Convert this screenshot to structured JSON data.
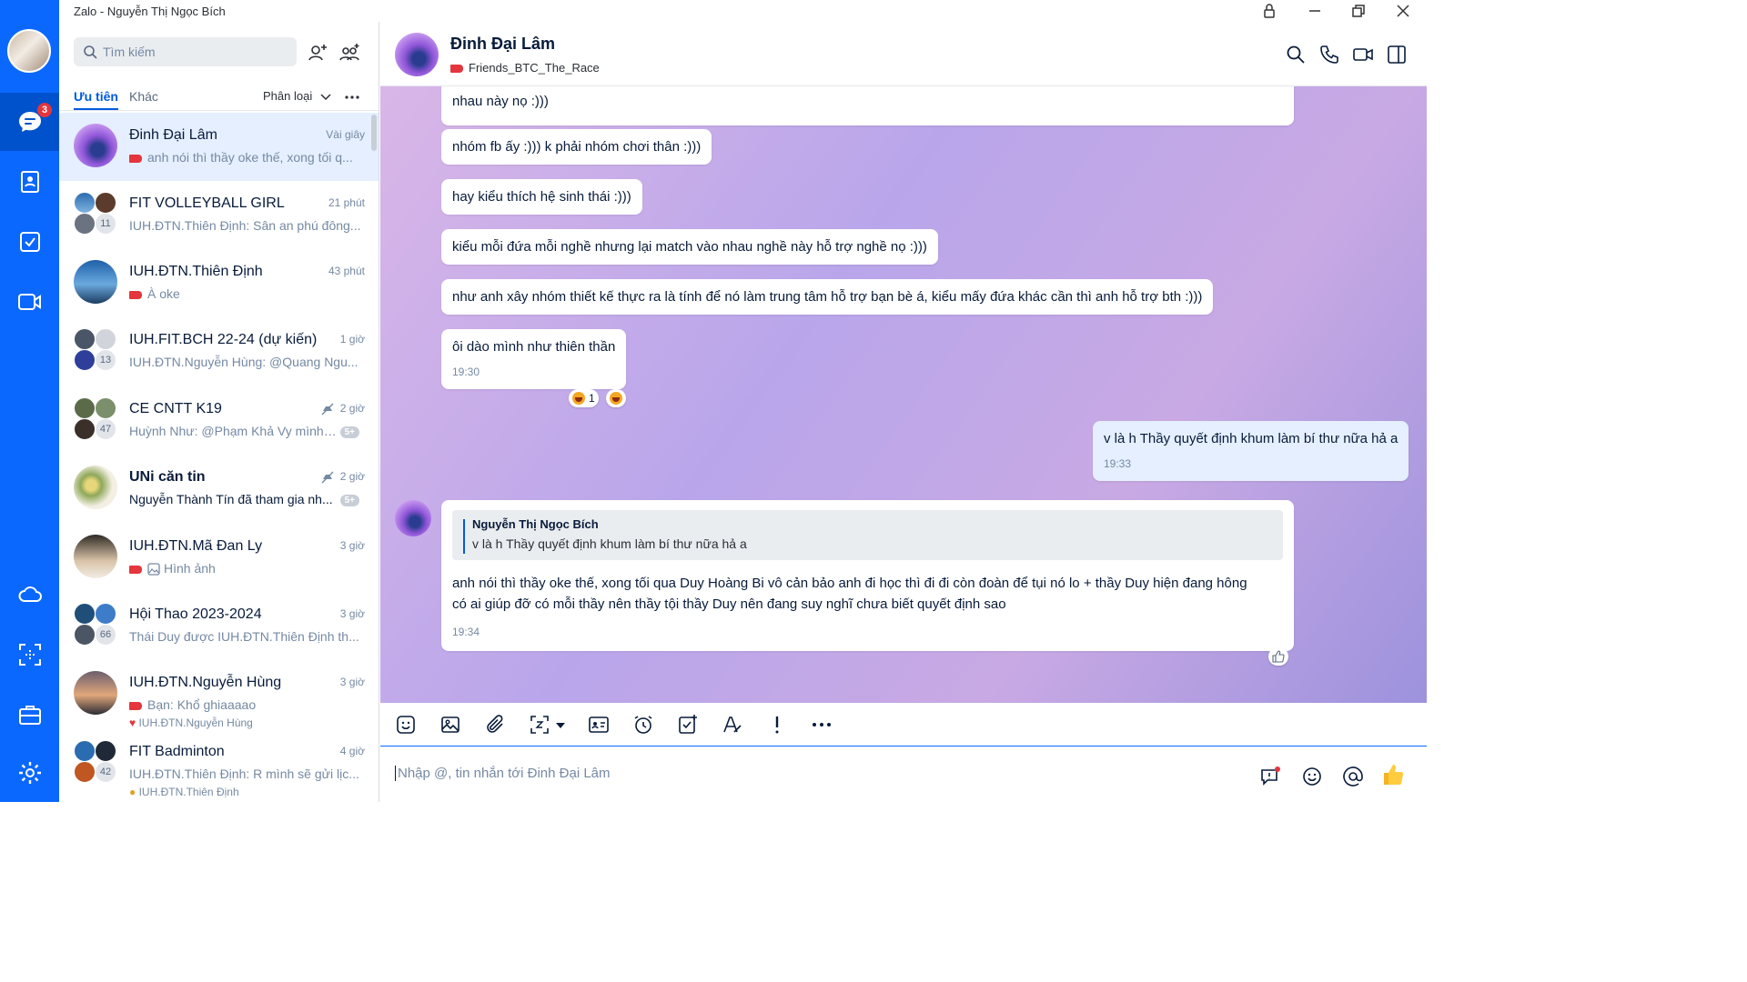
{
  "window": {
    "title": "Zalo - Nguyễn Thị Ngọc Bích"
  },
  "rail": {
    "unread_badge": "3"
  },
  "search": {
    "placeholder": "Tìm kiếm"
  },
  "list_tabs": {
    "priority": "Ưu tiên",
    "other": "Khác",
    "sort": "Phân loại"
  },
  "conversations": [
    {
      "name": "Đinh Đại Lâm",
      "time": "Vài giây",
      "preview": "anh nói thì thầy oke thế, xong tối q...",
      "tagged": true
    },
    {
      "name": "FIT VOLLEYBALL GIRL",
      "time": "21 phút",
      "preview": "IUH.ĐTN.Thiên Định: Sân an phú đông...",
      "members": "11"
    },
    {
      "name": "IUH.ĐTN.Thiên Định",
      "time": "43 phút",
      "preview": "À oke",
      "tagged": true
    },
    {
      "name": "IUH.FIT.BCH 22-24 (dự kiến)",
      "time": "1 giờ",
      "preview": "IUH.ĐTN.Nguyễn Hùng: @Quang Ngu...",
      "members": "13"
    },
    {
      "name": "CE CNTT K19",
      "time": "2 giờ",
      "preview": "Huỳnh Như: @Phạm Khả Vy mình l...",
      "members": "47",
      "unread": "5+"
    },
    {
      "name": "UNi căn tin",
      "time": "2 giờ",
      "preview": "Nguyễn Thành Tín đã tham gia nh...",
      "unread": "5+"
    },
    {
      "name": "IUH.ĐTN.Mã Đan Ly",
      "time": "3 giờ",
      "preview": "Hình ảnh",
      "tagged": true
    },
    {
      "name": "Hội Thao 2023-2024",
      "time": "3 giờ",
      "preview": "Thái Duy được IUH.ĐTN.Thiên Định th...",
      "members": "66"
    },
    {
      "name": "IUH.ĐTN.Nguyễn Hùng",
      "time": "3 giờ",
      "preview": "Bạn: Khổ ghiaaaao",
      "sub": "IUH.ĐTN.Nguyễn Hùng",
      "tagged": true
    },
    {
      "name": "FIT Badminton",
      "time": "4 giờ",
      "preview": "IUH.ĐTN.Thiên Định: R mình sẽ gửi lịc...",
      "sub": "IUH.ĐTN.Thiên Định",
      "members": "42"
    }
  ],
  "chat": {
    "name": "Đinh Đại Lâm",
    "label": "Friends_BTC_The_Race",
    "messages": [
      {
        "text": "nhau này nọ :)))"
      },
      {
        "text": "nhóm fb ấy :))) k phải nhóm chơi thân :)))"
      },
      {
        "text": "hay kiểu thích hệ sinh thái :)))"
      },
      {
        "text": "kiểu mỗi đứa mỗi nghề nhưng lại match vào nhau nghề này hỗ trợ nghề nọ :)))"
      },
      {
        "text": "như anh xây nhóm thiết kế thực ra là tính để nó làm trung tâm hỗ trợ bạn bè á, kiểu mấy đứa khác cần thì anh hỗ trợ bth :)))"
      },
      {
        "text": "ôi dào mình như thiên thần",
        "time": "19:30",
        "reaction_count": "1"
      },
      {
        "text": "v là h Thầy quyết định khum làm bí thư nữa hả a",
        "time": "19:33",
        "mine": true
      },
      {
        "quote_name": "Nguyễn Thị Ngọc Bích",
        "quote_text": "v là h Thầy quyết định khum làm bí thư nữa hả a",
        "line1": "anh nói thì thầy oke thế, xong tối qua Duy Hoàng Bi vô cản bảo anh đi học thì đi đi còn đoàn để tụi nó lo + thầy Duy hiện đang hông",
        "line2": "có ai giúp đỡ có mỗi thầy nên thầy tội thầy Duy nên đang suy nghĩ chưa biết quyết định sao",
        "time": "19:34"
      }
    ]
  },
  "composer": {
    "placeholder": "Nhập @, tin nhắn tới Đinh Đại Lâm"
  },
  "colors": {
    "brand": "#0a68ff",
    "rail_active": "#0052cc",
    "tag_red": "#e5353d",
    "selected_row": "#e5efff"
  }
}
